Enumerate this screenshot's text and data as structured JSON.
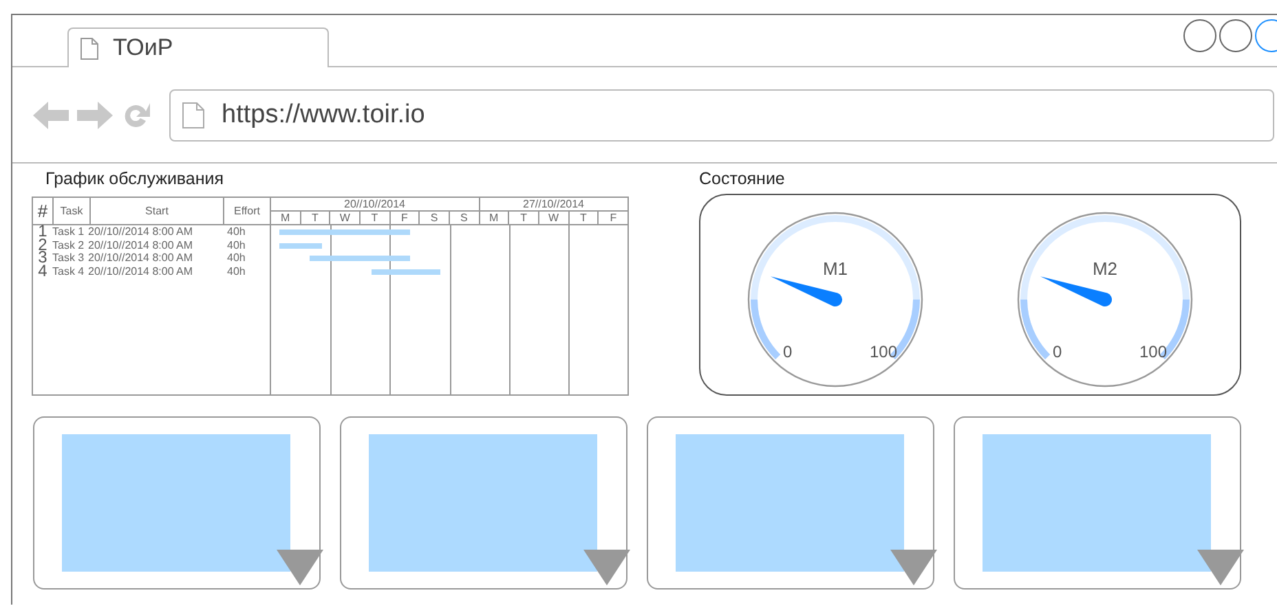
{
  "browser": {
    "tab_title": "ТОиР",
    "address": "https://www.toir.io"
  },
  "schedule": {
    "title": "График обслуживания",
    "columns": [
      "#",
      "Task",
      "Start",
      "Effort"
    ],
    "weeks": [
      {
        "label": "20//10//2014",
        "days": [
          "M",
          "T",
          "W",
          "T",
          "F",
          "S",
          "S"
        ]
      },
      {
        "label": "27//10//2014",
        "days": [
          "M",
          "T",
          "W",
          "T",
          "F"
        ]
      }
    ],
    "rows": [
      {
        "number": "1",
        "task": "Task 1",
        "start": "20//10//2014 8:00 AM",
        "effort": "40h"
      },
      {
        "number": "2",
        "task": "Task 2",
        "start": "20//10//2014 8:00 AM",
        "effort": "40h"
      },
      {
        "number": "3",
        "task": "Task 3",
        "start": "20//10//2014 8:00 AM",
        "effort": "40h"
      },
      {
        "number": "4",
        "task": "Task 4",
        "start": "20//10//2014 8:00 AM",
        "effort": "40h"
      }
    ]
  },
  "status": {
    "title": "Состояние",
    "gauges": [
      {
        "label": "M1",
        "min": "0",
        "max": "100",
        "level": 0.24
      },
      {
        "label": "M2",
        "min": "0",
        "max": "100",
        "level": 0.24
      }
    ]
  },
  "cards": [
    {
      "kind": "image"
    },
    {
      "kind": "image"
    },
    {
      "kind": "image"
    },
    {
      "kind": "image"
    }
  ]
}
